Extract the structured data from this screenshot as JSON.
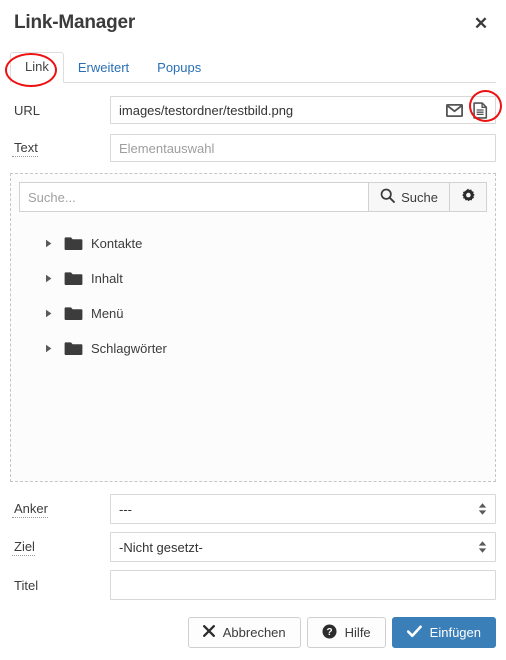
{
  "dialog": {
    "title": "Link-Manager",
    "close_label": "✕",
    "close_icon": "close-icon"
  },
  "tabs": [
    {
      "label": "Link",
      "active": true
    },
    {
      "label": "Erweitert",
      "active": false
    },
    {
      "label": "Popups",
      "active": false
    }
  ],
  "form": {
    "url": {
      "label": "URL",
      "value": "images/testordner/testbild.png",
      "placeholder": "",
      "icons": [
        "mail-icon",
        "document-icon"
      ]
    },
    "text": {
      "label": "Text",
      "value": "",
      "placeholder": "Elementauswahl"
    },
    "anker": {
      "label": "Anker",
      "value": "---"
    },
    "ziel": {
      "label": "Ziel",
      "value": "-Nicht gesetzt-"
    },
    "titel": {
      "label": "Titel",
      "value": "",
      "placeholder": ""
    }
  },
  "picker": {
    "search": {
      "placeholder": "Suche...",
      "value": "",
      "button_label": "Suche",
      "search_icon": "search-icon",
      "settings_icon": "gear-icon"
    },
    "tree": [
      {
        "label": "Kontakte",
        "icon": "folder-icon",
        "expanded": false
      },
      {
        "label": "Inhalt",
        "icon": "folder-icon",
        "expanded": false
      },
      {
        "label": "Menü",
        "icon": "folder-icon",
        "expanded": false
      },
      {
        "label": "Schlagwörter",
        "icon": "folder-icon",
        "expanded": false
      }
    ]
  },
  "footer": {
    "cancel": {
      "label": "Abbrechen",
      "icon": "x-icon"
    },
    "help": {
      "label": "Hilfe",
      "icon": "question-circle-icon"
    },
    "insert": {
      "label": "Einfügen",
      "icon": "check-icon"
    }
  },
  "colors": {
    "primary": "#3b7fb8",
    "tab_link": "#2a6fb5",
    "annotation": "#ee1111",
    "folder": "#3c3c3c"
  }
}
